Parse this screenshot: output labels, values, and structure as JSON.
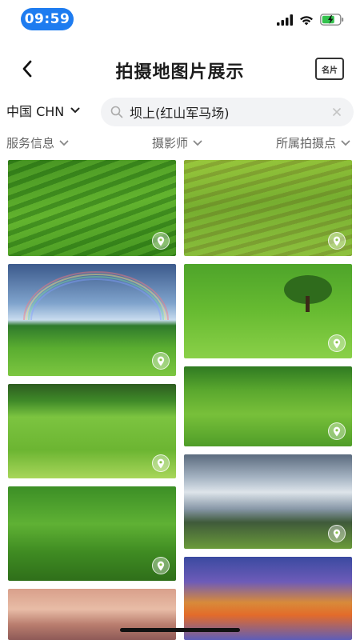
{
  "status": {
    "time": "09:59"
  },
  "nav": {
    "title": "拍摄地图片展示",
    "card_label": "名片"
  },
  "search": {
    "country": "中国 CHN",
    "query": "坝上(红山军马场)"
  },
  "filters": [
    {
      "label": "服务信息"
    },
    {
      "label": "摄影师"
    },
    {
      "label": "所属拍摄点"
    }
  ],
  "colors": {
    "accent": "#1e7cf0",
    "search_bg": "#f2f3f5",
    "filter_text": "#666666"
  },
  "icons": {
    "back": "chevron-left-icon",
    "card": "name-card-icon",
    "search": "search-icon",
    "clear": "close-icon",
    "dropdown": "chevron-down-icon",
    "location": "location-pin-icon"
  }
}
